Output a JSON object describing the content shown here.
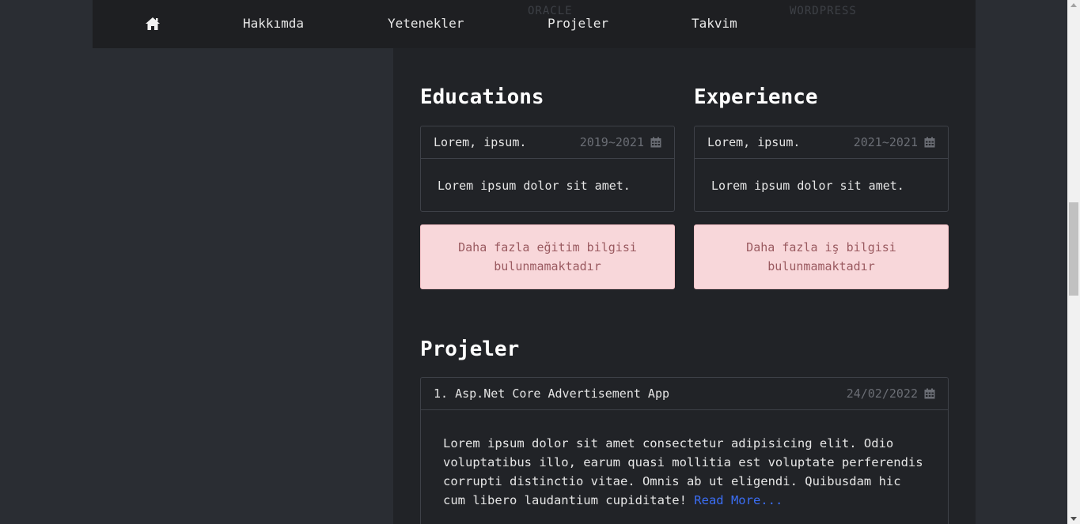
{
  "nav": {
    "home_icon": "home-icon",
    "items": [
      "Hakkımda",
      "Yetenekler",
      "Projeler",
      "Takvim"
    ],
    "ghost_labels": [
      "ORACLE",
      "WORDPRESS"
    ]
  },
  "educations": {
    "title": "Educations",
    "card": {
      "name": "Lorem, ipsum.",
      "date": "2019~2021",
      "body": "Lorem ipsum dolor sit amet."
    },
    "alert": "Daha fazla eğitim bilgisi bulunmamaktadır"
  },
  "experience": {
    "title": "Experience",
    "card": {
      "name": "Lorem, ipsum.",
      "date": "2021~2021",
      "body": "Lorem ipsum dolor sit amet."
    },
    "alert": "Daha fazla iş bilgisi bulunmamaktadır"
  },
  "projects": {
    "title": "Projeler",
    "items": [
      {
        "name": "1. Asp.Net Core Advertisement App",
        "date": "24/02/2022",
        "body": "Lorem ipsum dolor sit amet consectetur adipisicing elit. Odio voluptatibus illo, earum quasi mollitia est voluptate perferendis corrupti distinctio vitae. Omnis ab ut eligendi. Quibusdam hic cum libero laudantium cupiditate!",
        "read_more": "Read More..."
      }
    ]
  },
  "colors": {
    "page_bg": "#2a2d33",
    "main_bg": "#212327",
    "nav_bg": "#1e1f22",
    "alert_bg": "#f8d7da",
    "alert_text": "#9a5a60",
    "link": "#3b6ef5"
  }
}
